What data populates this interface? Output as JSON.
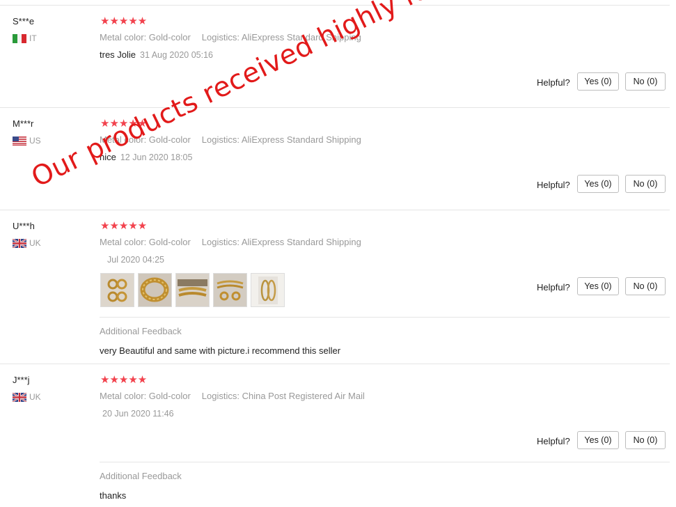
{
  "reviews": [
    {
      "user": "S***e",
      "country": "IT",
      "meta_color": "Metal color: Gold-color",
      "meta_logistics": "Logistics: AliExpress Standard Shipping",
      "text": "tres Jolie",
      "date": "31 Aug 2020 05:16",
      "helpful_label": "Helpful?",
      "yes": "Yes (0)",
      "no": "No (0)"
    },
    {
      "user": "M***r",
      "country": "US",
      "meta_color": "Metal color: Gold-color",
      "meta_logistics": "Logistics: AliExpress Standard Shipping",
      "text": "nice",
      "date": "12 Jun 2020 18:05",
      "helpful_label": "Helpful?",
      "yes": "Yes (0)",
      "no": "No (0)"
    },
    {
      "user": "U***h",
      "country": "UK",
      "meta_color": "Metal color: Gold-color",
      "meta_logistics": "Logistics: AliExpress Standard Shipping",
      "date": "Jul 2020 04:25",
      "helpful_label": "Helpful?",
      "yes": "Yes (0)",
      "no": "No (0)",
      "additional_title": "Additional Feedback",
      "additional_text": "very Beautiful and same with picture.i recommend this seller"
    },
    {
      "user": "J***j",
      "country": "UK",
      "meta_color": "Metal color: Gold-color",
      "meta_logistics": "Logistics: China Post Registered Air Mail",
      "date": "20 Jun 2020 11:46",
      "helpful_label": "Helpful?",
      "yes": "Yes (0)",
      "no": "No (0)",
      "additional_title": "Additional Feedback",
      "additional_text": "thanks"
    }
  ],
  "stars": "★★★★★",
  "watermark": "Our products received highly favorable reviews",
  "colors": {
    "star": "#f2424d",
    "watermark": "#e21a1a",
    "muted": "#999999"
  }
}
